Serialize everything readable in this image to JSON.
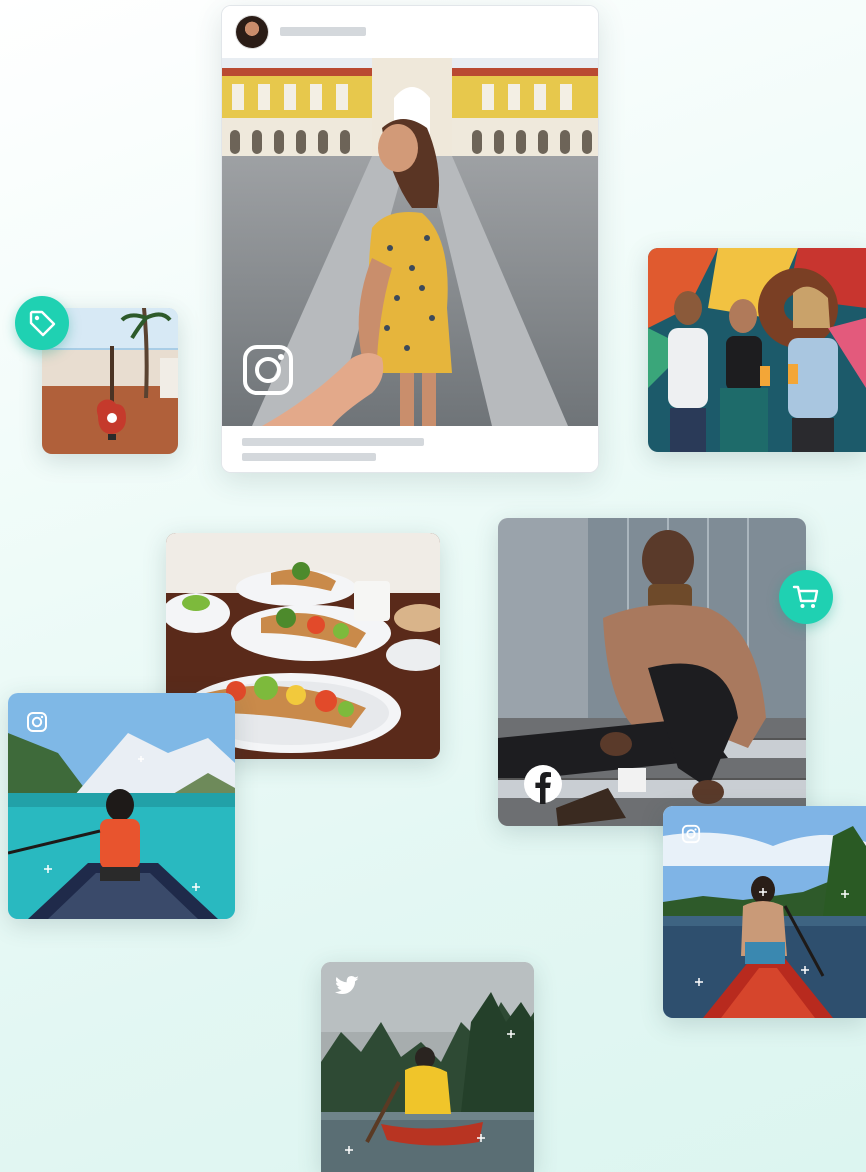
{
  "cards": {
    "main_post": {
      "network": "instagram"
    },
    "guitar": {
      "badge": "tag-icon"
    },
    "friends": {},
    "food": {},
    "man_stairs": {
      "network": "facebook",
      "badge": "cart-icon"
    },
    "canoe_mountain": {
      "network": "instagram"
    },
    "canoe_lake": {
      "network": "instagram"
    },
    "canoe_rain": {
      "network": "twitter"
    }
  },
  "colors": {
    "accent": "#1fd1b2",
    "background": "#e3f7f3",
    "placeholder_bar": "#d4d8dc"
  }
}
